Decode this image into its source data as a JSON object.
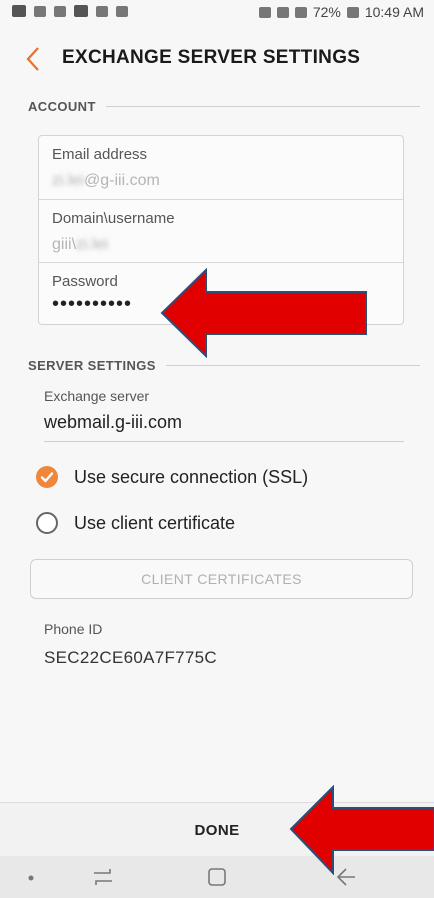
{
  "status_bar": {
    "battery": "72%",
    "time": "10:49 AM"
  },
  "header": {
    "back_icon": "chevron-left-icon",
    "title": "EXCHANGE SERVER SETTINGS"
  },
  "account": {
    "section_title": "ACCOUNT",
    "fields": [
      {
        "label": "Email address",
        "value_prefix": "zi.lei",
        "value_suffix": "@g-iii.com"
      },
      {
        "label": "Domain\\username",
        "value_prefix": "giii\\",
        "value_suffix": "zi.lei"
      },
      {
        "label": "Password",
        "value": "••••••••••"
      }
    ]
  },
  "server_settings": {
    "section_title": "SERVER SETTINGS",
    "exchange_label": "Exchange server",
    "exchange_value": "webmail.g-iii.com",
    "ssl_label": "Use secure connection (SSL)",
    "ssl_checked": true,
    "client_cert_label": "Use client certificate",
    "client_cert_checked": false,
    "client_cert_button": "CLIENT CERTIFICATES"
  },
  "phone": {
    "label": "Phone ID",
    "value": "SEC22CE60A7F775C"
  },
  "footer": {
    "done_label": "DONE"
  },
  "colors": {
    "accent": "#f0863a",
    "annotation_arrow": "#e00000"
  }
}
